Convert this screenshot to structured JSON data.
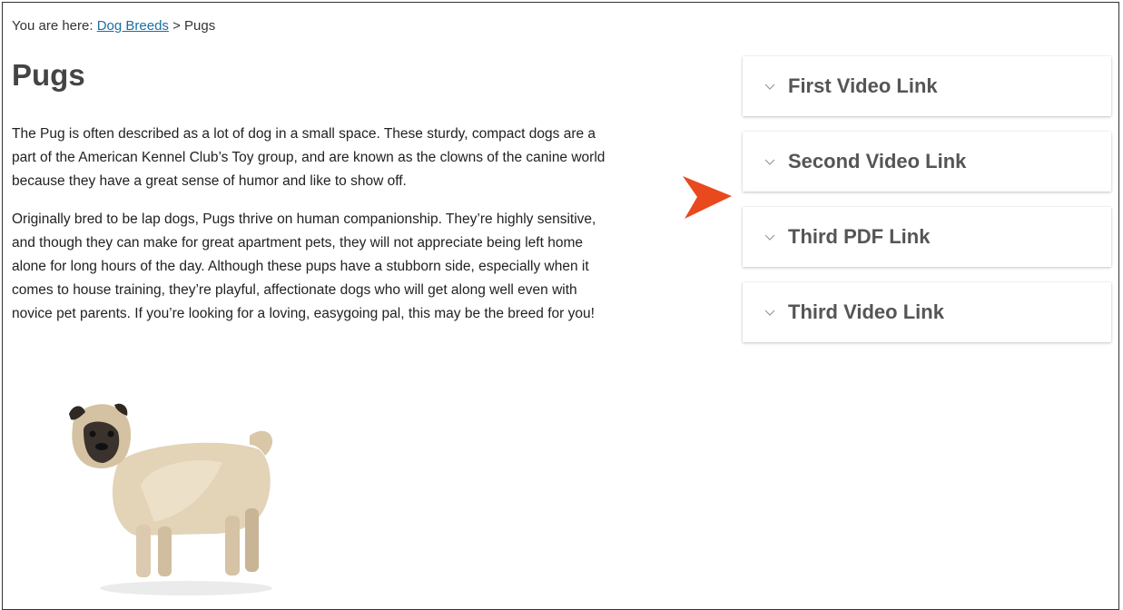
{
  "breadcrumb": {
    "prefix": "You are here:",
    "link_label": "Dog Breeds",
    "separator": ">",
    "current": "Pugs"
  },
  "page": {
    "title": "Pugs",
    "paragraphs": [
      [
        "The Pug is often described as a lot of dog in a small space. These sturdy, compact dogs are a",
        "part of the American Kennel Club’s Toy group, and are known as the clowns of the canine world",
        "because they have a great sense of humor and like to show off."
      ],
      [
        "Originally bred to be lap dogs, Pugs thrive on human companionship. They’re highly sensitive,",
        "and though they can make for great apartment pets, they will not appreciate being left home",
        "alone for long hours of the day. Although these pups have a stubborn side, especially when it",
        "comes to house training, they’re playful, affectionate dogs who will get along well even with",
        "novice pet parents. If you’re looking for a loving, easygoing pal, this may be the breed for you!"
      ]
    ]
  },
  "accordion": {
    "items": [
      {
        "label": "First Video Link",
        "icon": "chevron-down-icon"
      },
      {
        "label": "Second Video Link",
        "icon": "chevron-down-icon"
      },
      {
        "label": "Third PDF Link",
        "icon": "chevron-down-icon"
      },
      {
        "label": "Third Video Link",
        "icon": "chevron-down-icon"
      }
    ]
  },
  "colors": {
    "link": "#1a6fa3",
    "pointer": "#e8491d",
    "title": "#444444"
  }
}
